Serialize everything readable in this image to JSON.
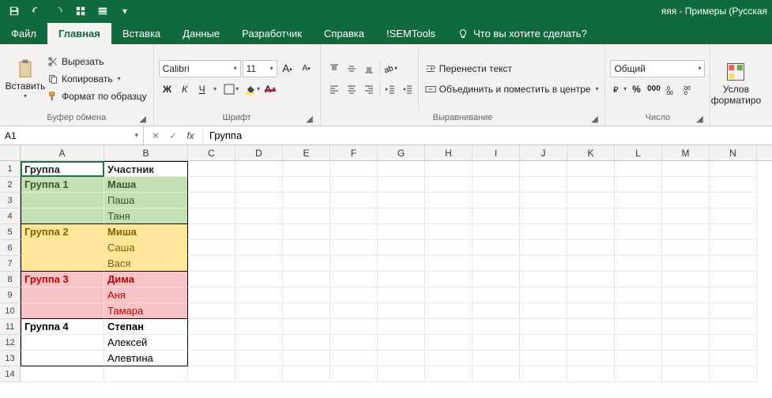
{
  "app": {
    "doc_title": "яяя - Примеры (Русская"
  },
  "tabs": {
    "file": "Файл",
    "home": "Главная",
    "insert": "Вставка",
    "data": "Данные",
    "developer": "Разработчик",
    "help": "Справка",
    "semtools": "!SEMTools",
    "tellme": "Что вы хотите сделать?"
  },
  "ribbon": {
    "clipboard": {
      "paste": "Вставить",
      "cut": "Вырезать",
      "copy": "Копировать",
      "format_painter": "Формат по образцу",
      "group": "Буфер обмена"
    },
    "font": {
      "name": "Calibri",
      "size": "11",
      "group": "Шрифт"
    },
    "alignment": {
      "wrap": "Перенести текст",
      "merge": "Объединить и поместить в центре",
      "group": "Выравнивание"
    },
    "number": {
      "format": "Общий",
      "group": "Число"
    },
    "styles": {
      "cond": "Услов\nформатиро"
    }
  },
  "formula_bar": {
    "name_box": "A1",
    "formula": "Группа"
  },
  "grid": {
    "cols": [
      "A",
      "B",
      "C",
      "D",
      "E",
      "F",
      "G",
      "H",
      "I",
      "J",
      "K",
      "L",
      "M",
      "N"
    ],
    "rows": [
      {
        "n": "1",
        "a": "Группа",
        "b": "Участник",
        "style": "hdr",
        "topBorder": true
      },
      {
        "n": "2",
        "a": "Группа 1",
        "b": "Маша",
        "style": "g1b"
      },
      {
        "n": "3",
        "a": "",
        "b": "Паша",
        "style": "g1"
      },
      {
        "n": "4",
        "a": "",
        "b": "Таня",
        "style": "g1",
        "botBorder": true
      },
      {
        "n": "5",
        "a": "Группа 2",
        "b": "Миша",
        "style": "g2b"
      },
      {
        "n": "6",
        "a": "",
        "b": "Саша",
        "style": "g2"
      },
      {
        "n": "7",
        "a": "",
        "b": "Вася",
        "style": "g2",
        "botBorder": true
      },
      {
        "n": "8",
        "a": "Группа 3",
        "b": "Дима",
        "style": "g3b"
      },
      {
        "n": "9",
        "a": "",
        "b": "Аня",
        "style": "g3"
      },
      {
        "n": "10",
        "a": "",
        "b": "Тамара",
        "style": "g3",
        "botBorder": true
      },
      {
        "n": "11",
        "a": "Группа 4",
        "b": "Степан",
        "style": "g4b"
      },
      {
        "n": "12",
        "a": "",
        "b": "Алексей",
        "style": "g4"
      },
      {
        "n": "13",
        "a": "",
        "b": "Алевтина",
        "style": "g4",
        "botBorder": true
      },
      {
        "n": "14",
        "a": "",
        "b": "",
        "style": ""
      }
    ]
  }
}
